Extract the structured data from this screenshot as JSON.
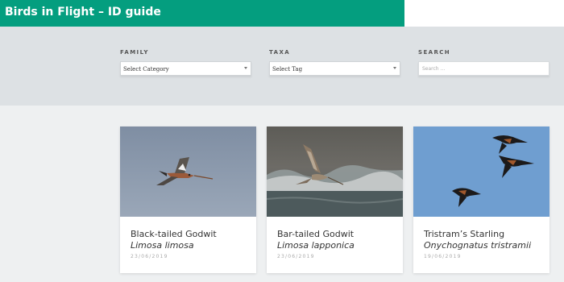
{
  "header": {
    "title": "Birds in Flight – ID guide"
  },
  "filters": {
    "family": {
      "label": "FAMILY",
      "value": "Select Category"
    },
    "taxa": {
      "label": "TAXA",
      "value": "Select Tag"
    },
    "search": {
      "label": "SEARCH",
      "placeholder": "Search ..."
    }
  },
  "cards": [
    {
      "title": "Black-tailed Godwit",
      "latin": "Limosa limosa",
      "date": "23/06/2019"
    },
    {
      "title": "Bar-tailed Godwit",
      "latin": "Limosa lapponica",
      "date": "23/06/2019"
    },
    {
      "title": "Tristram’s Starling",
      "latin": "Onychognatus tristramii",
      "date": "19/06/2019"
    }
  ],
  "colors": {
    "brand": "#049e7f",
    "filter_band": "#dde1e4",
    "page_bg": "#eef0f1"
  }
}
